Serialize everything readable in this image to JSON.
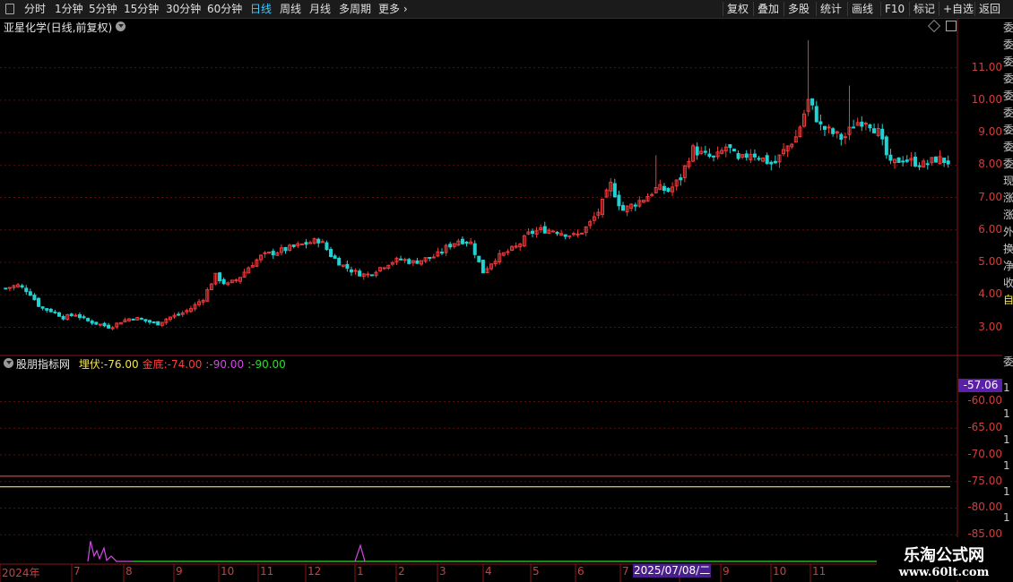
{
  "toolbar": {
    "left_items": [
      "分时",
      "1分钟",
      "5分钟",
      "15分钟",
      "30分钟",
      "60分钟",
      "日线",
      "周线",
      "月线",
      "多周期",
      "更多"
    ],
    "active_index": 6,
    "right_items": [
      "复权",
      "叠加",
      "多股",
      "统计",
      "画线",
      "F10",
      "标记",
      "+自选",
      "返回"
    ]
  },
  "stock": {
    "title": "亚星化学(日线,前复权)"
  },
  "price_axis": {
    "labels": [
      "11.00",
      "10.00",
      "9.00",
      "8.00",
      "7.00",
      "6.00",
      "5.00",
      "4.00",
      "3.00"
    ]
  },
  "indicator": {
    "name": "股朋指标网",
    "items": [
      {
        "label": "埋伏",
        "value": "-76.00",
        "color": "#f2e44b"
      },
      {
        "label": "金底",
        "value": "-74.00",
        "color": "#ff3b3b"
      },
      {
        "label": "",
        "value": "-90.00",
        "color": "#d04adf"
      },
      {
        "label": "",
        "value": "-90.00",
        "color": "#27e027"
      }
    ],
    "current_value": "-57.06",
    "axis_labels": [
      "-60.00",
      "-65.00",
      "-70.00",
      "-75.00",
      "-80.00",
      "-85.00"
    ]
  },
  "time_axis": {
    "labels": [
      "2024年",
      "7",
      "8",
      "9",
      "10",
      "11",
      "12",
      "1",
      "2",
      "3",
      "4",
      "5",
      "6",
      "7",
      "8",
      "9",
      "10",
      "11"
    ],
    "cursor_date": "2025/07/08/二"
  },
  "right_strip": {
    "chars": [
      "委",
      "委",
      "委",
      "委",
      "委",
      "委",
      "委",
      "委",
      "委",
      "现",
      "涨",
      "涨",
      "外",
      "换",
      "净",
      "收",
      "自",
      "委",
      "1",
      "1",
      "1",
      "1",
      "1",
      "1",
      "1",
      "1"
    ]
  },
  "watermark": {
    "line1": "乐淘公式网",
    "line2": "www.60lt.com"
  },
  "colors": {
    "up": "#f03a3a",
    "down": "#22d2d2",
    "grid": "#5a0d0d",
    "active_tab": "#3fc9ff"
  },
  "chart_data": {
    "type": "candlestick",
    "title": "亚星化学(日线,前复权)",
    "ylim": [
      2.6,
      11.9
    ],
    "ticks_y": [
      3,
      4,
      5,
      6,
      7,
      8,
      9,
      10,
      11
    ],
    "x_labels": [
      "2024年",
      "7",
      "8",
      "9",
      "10",
      "11",
      "12",
      "1",
      "2",
      "3",
      "4",
      "5",
      "6",
      "7",
      "8",
      "9",
      "10",
      "11"
    ],
    "close_path": [
      4.2,
      4.3,
      4.1,
      3.6,
      3.5,
      3.3,
      3.4,
      3.2,
      3.1,
      3.0,
      3.2,
      3.3,
      3.2,
      3.1,
      3.3,
      3.4,
      3.6,
      3.9,
      4.6,
      4.3,
      4.5,
      4.9,
      5.2,
      5.3,
      5.4,
      5.5,
      5.6,
      5.7,
      5.2,
      4.9,
      4.7,
      4.6,
      4.8,
      5.0,
      5.1,
      5.0,
      5.1,
      5.2,
      5.5,
      5.7,
      5.6,
      4.7,
      5.1,
      5.3,
      5.5,
      5.9,
      6.0,
      6.0,
      5.9,
      5.8,
      6.1,
      6.6,
      7.4,
      6.6,
      6.8,
      7.0,
      7.3,
      7.2,
      7.6,
      8.5,
      8.3,
      8.2,
      8.6,
      8.1,
      8.4,
      8.2,
      8.0,
      8.5,
      8.9,
      10.0,
      9.2,
      9.0,
      8.8,
      9.3,
      9.4,
      9.0,
      8.0,
      8.2,
      8.1,
      8.0,
      8.2,
      8.1
    ]
  }
}
